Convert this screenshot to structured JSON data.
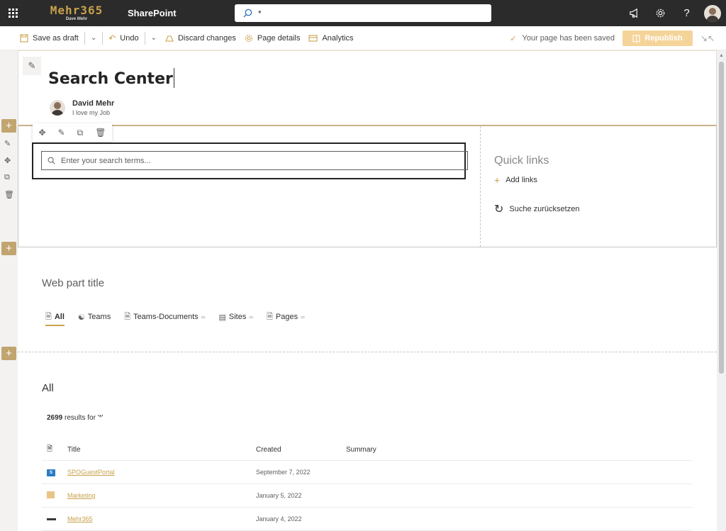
{
  "suite": {
    "brand": "Mehr365",
    "brand_sub": "Dave Mehr",
    "app_name": "SharePoint",
    "search_query": "*"
  },
  "command_bar": {
    "save_draft": "Save as draft",
    "undo": "Undo",
    "discard": "Discard changes",
    "page_details": "Page details",
    "analytics": "Analytics",
    "saved_status": "Your page has been saved",
    "republish": "Republish"
  },
  "page": {
    "title": "Search Center",
    "author_name": "David Mehr",
    "author_role": "I love my Job"
  },
  "search_box": {
    "placeholder": "Enter your search terms..."
  },
  "quick_links": {
    "title": "Quick links",
    "add_label": "Add links",
    "reset_label": "Suche zurücksetzen"
  },
  "verticals": {
    "title": "Web part title",
    "tabs": [
      {
        "label": "All"
      },
      {
        "label": "Teams"
      },
      {
        "label": "Teams-Documents"
      },
      {
        "label": "Sites"
      },
      {
        "label": "Pages"
      }
    ]
  },
  "results": {
    "title": "All",
    "count": "2699",
    "count_suffix": "results for '*'",
    "columns": {
      "title": "Title",
      "created": "Created",
      "summary": "Summary"
    },
    "rows": [
      {
        "title": "SPOGuestPortal",
        "created": "September 7, 2022",
        "summary": "",
        "icon": "sharepoint-site-icon"
      },
      {
        "title": "Marketing",
        "created": "January 5, 2022",
        "summary": "",
        "icon": "site-logo-icon"
      },
      {
        "title": "Mehr365",
        "created": "January 4, 2022",
        "summary": "",
        "icon": "brand-logo-icon"
      }
    ]
  },
  "colors": {
    "accent": "#c8a14b",
    "suitebar": "#2b2b2b",
    "republish_bg": "#f5d49a"
  }
}
